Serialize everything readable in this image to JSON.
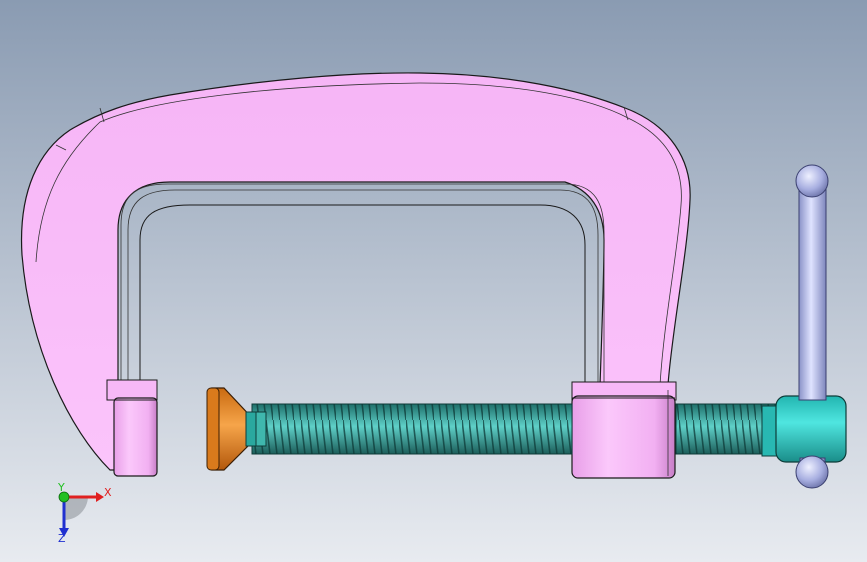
{
  "viewport": {
    "background_top": "#8a9bb2",
    "background_bottom": "#e6eaf0"
  },
  "model": {
    "parts": [
      {
        "name": "c-frame",
        "color": "#fbbcfb"
      },
      {
        "name": "swivel-pad",
        "color": "#e58a2a"
      },
      {
        "name": "threaded-screw",
        "color": "#3fa9a0"
      },
      {
        "name": "screw-handle-hub",
        "color": "#2ac9c4"
      },
      {
        "name": "tommy-bar",
        "color": "#b6bde8"
      }
    ]
  },
  "triad": {
    "x_label": "X",
    "y_label": "Y",
    "z_label": "Z",
    "x_color": "#e02020",
    "y_color": "#22c022",
    "z_color": "#2030d0"
  }
}
